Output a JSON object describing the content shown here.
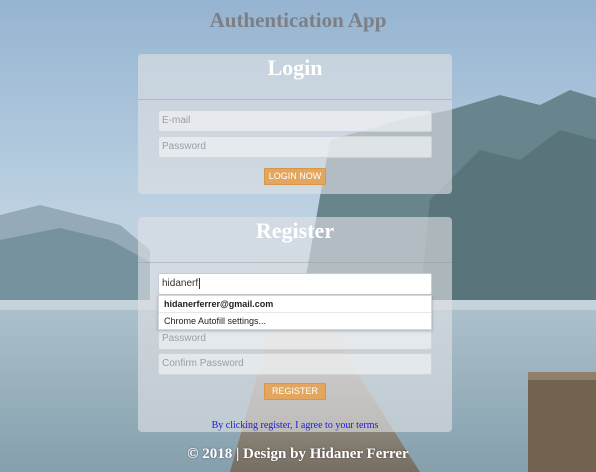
{
  "app": {
    "title": "Authentication App"
  },
  "login": {
    "title": "Login",
    "email_placeholder": "E-mail",
    "password_placeholder": "Password",
    "button_label": "LOGIN NOW"
  },
  "register": {
    "title": "Register",
    "email_value": "hidanerf",
    "password_placeholder": "Password",
    "confirm_placeholder": "Confirm Password",
    "button_label": "REGISTER",
    "terms_text": "By clicking register, I agree to your terms"
  },
  "autofill": {
    "suggestion": "hidanerferrer@gmail.com",
    "settings": "Chrome Autofill settings..."
  },
  "footer": {
    "text": "© 2018 | Design by Hidaner Ferrer"
  },
  "colors": {
    "button": "#e3a65f",
    "terms_link": "#1a1ad8",
    "title_gray": "#7d7f84"
  }
}
